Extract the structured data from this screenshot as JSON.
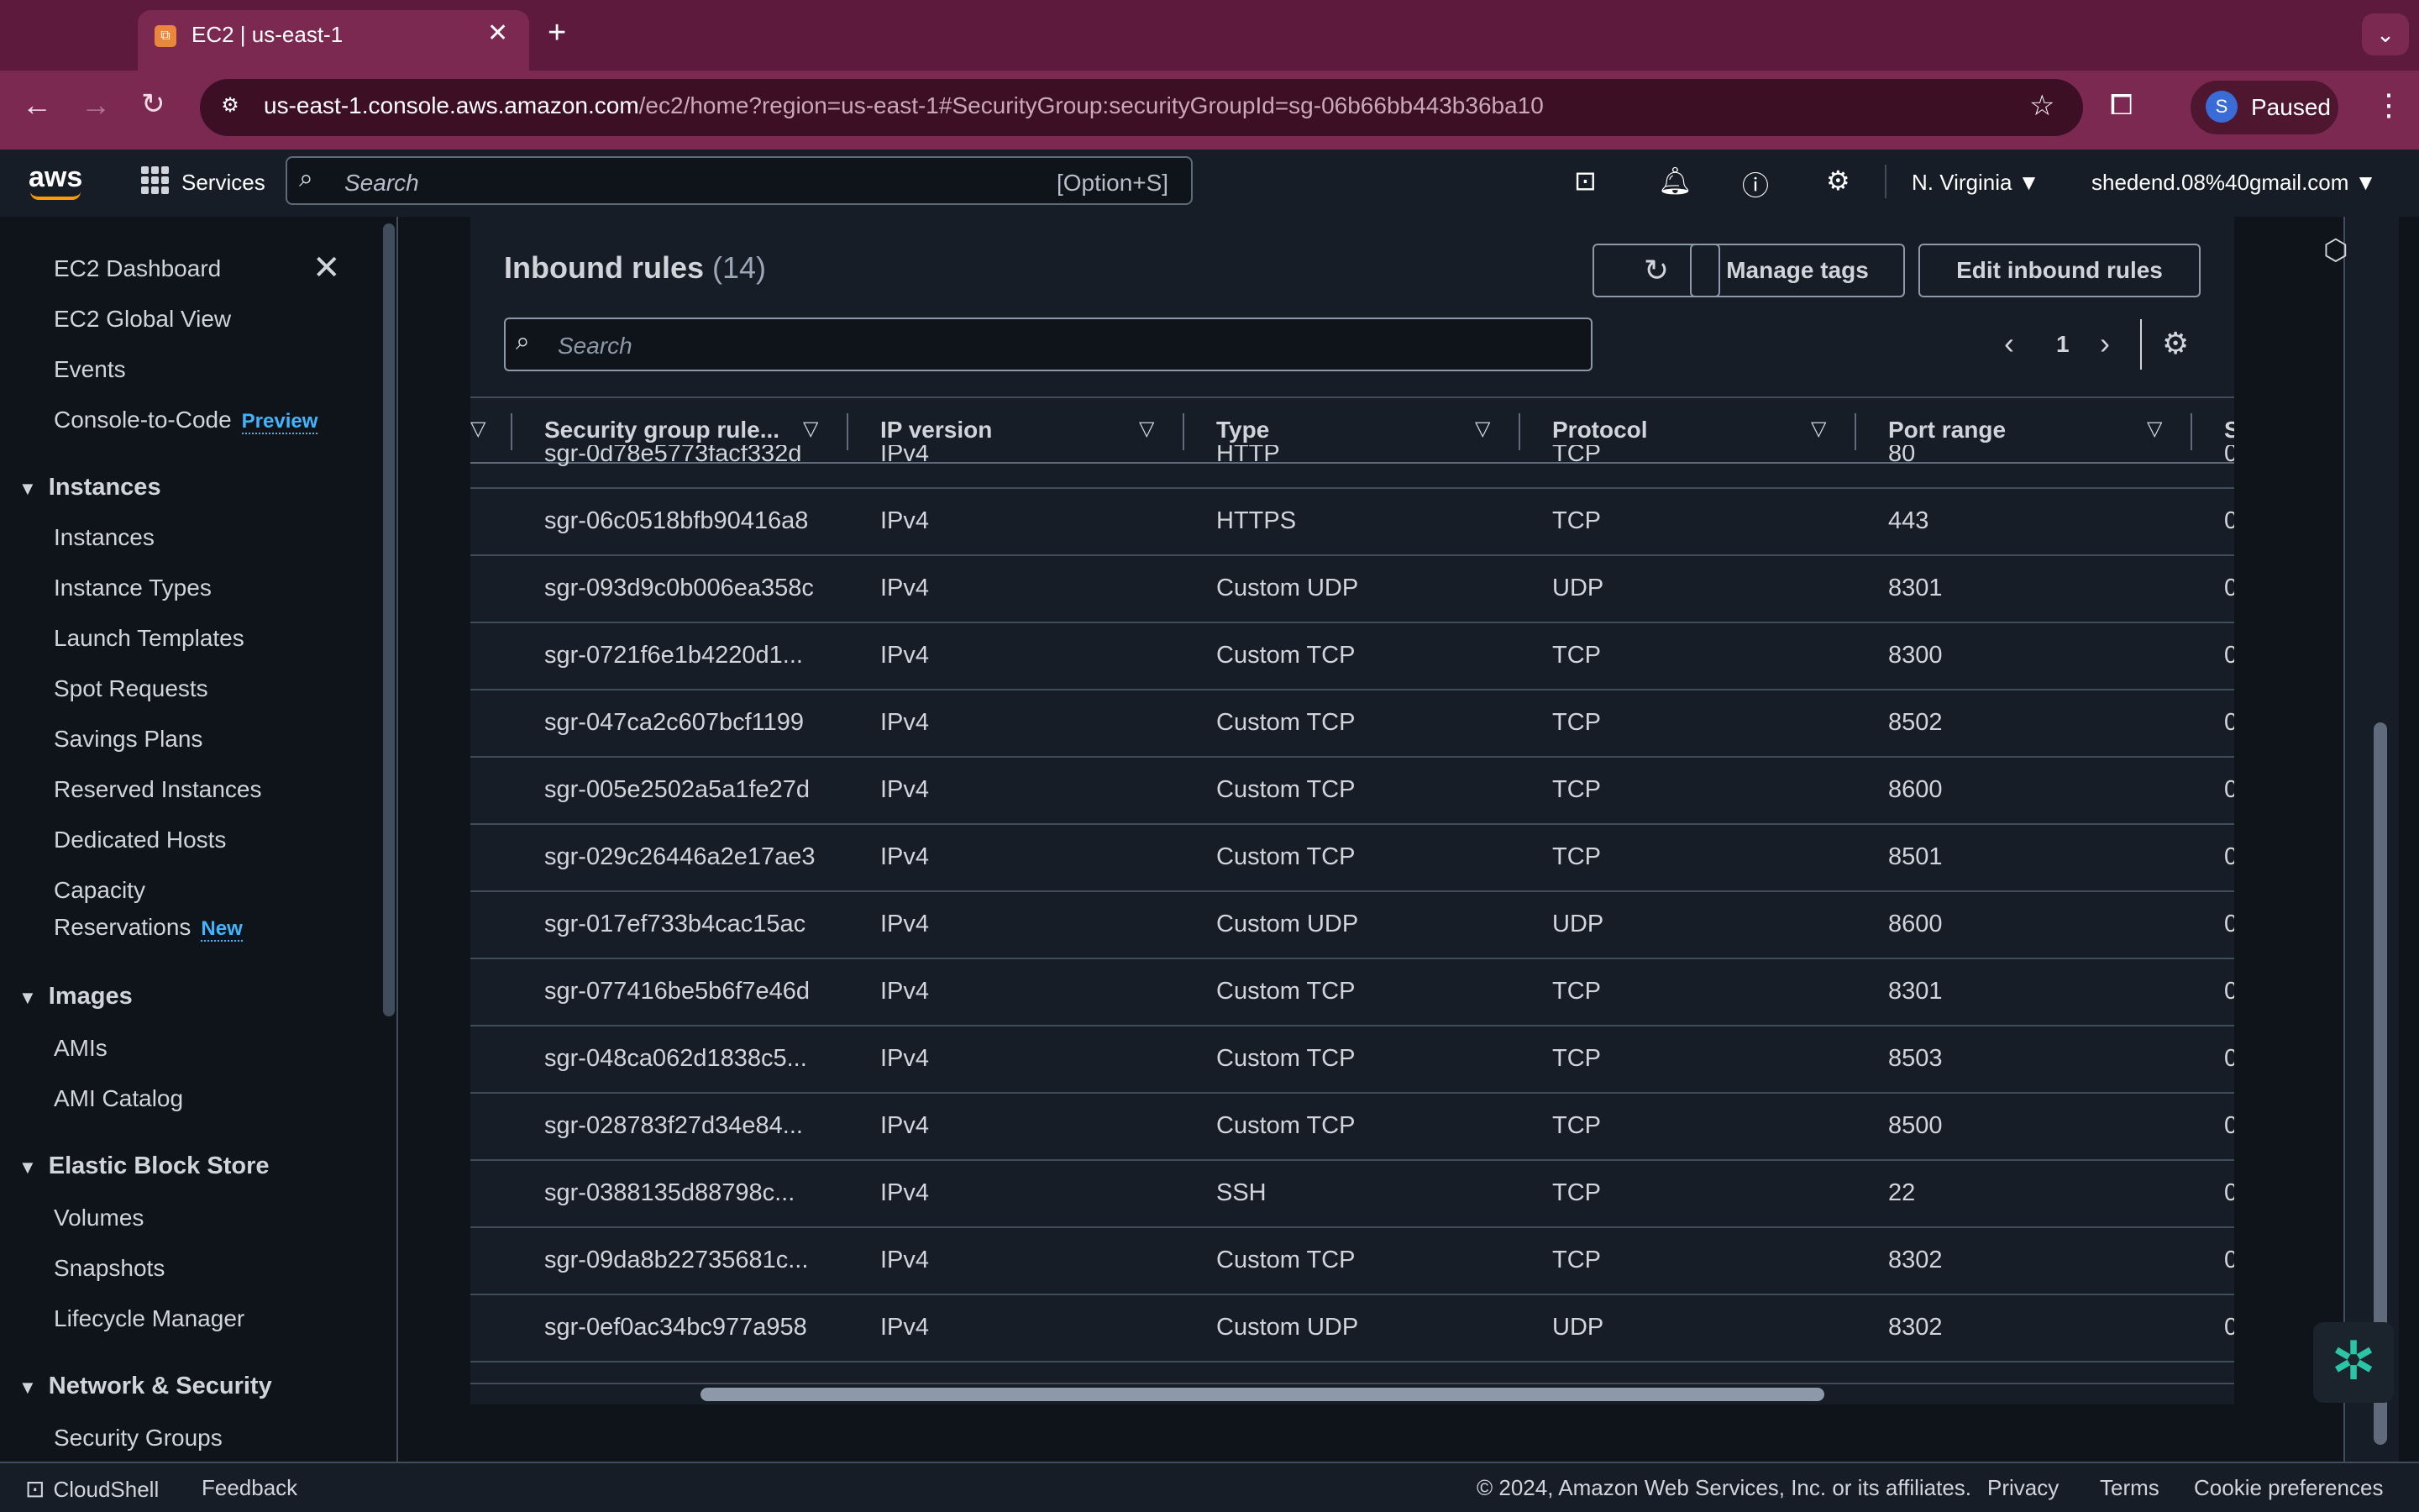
{
  "browser": {
    "tab_title": "EC2 | us-east-1",
    "url_host": "us-east-1.console.aws.amazon.com",
    "url_path": "/ec2/home?region=us-east-1#SecurityGroup:securityGroupId=sg-06b66bb443b36ba10",
    "profile_initial": "S",
    "profile_label": "Paused"
  },
  "awsnav": {
    "logo": "aws",
    "services_label": "Services",
    "search_placeholder": "Search",
    "search_shortcut": "[Option+S]",
    "region": "N. Virginia ▼",
    "account": "shedend.08%40gmail.com ▼"
  },
  "sidebar": {
    "top_items": [
      "EC2 Dashboard",
      "EC2 Global View",
      "Events",
      "Console-to-Code"
    ],
    "preview_tag": "Preview",
    "sections": [
      {
        "heading": "Instances",
        "items": [
          "Instances",
          "Instance Types",
          "Launch Templates",
          "Spot Requests",
          "Savings Plans",
          "Reserved Instances",
          "Dedicated Hosts",
          "Capacity",
          "Reservations"
        ]
      },
      {
        "heading": "Images",
        "items": [
          "AMIs",
          "AMI Catalog"
        ]
      },
      {
        "heading": "Elastic Block Store",
        "items": [
          "Volumes",
          "Snapshots",
          "Lifecycle Manager"
        ]
      },
      {
        "heading": "Network & Security",
        "items": [
          "Security Groups"
        ]
      }
    ],
    "new_tag": "New"
  },
  "inbound": {
    "title": "Inbound rules",
    "count": "(14)",
    "btn_manage_tags": "Manage tags",
    "btn_edit": "Edit inbound rules",
    "search_placeholder": "Search",
    "page": "1",
    "columns": [
      "Security group rule...",
      "IP version",
      "Type",
      "Protocol",
      "Port range",
      "S"
    ],
    "rows": [
      [
        "sgr-0d78e5773facf332d",
        "IPv4",
        "HTTP",
        "TCP",
        "80",
        "0"
      ],
      [
        "sgr-06c0518bfb90416a8",
        "IPv4",
        "HTTPS",
        "TCP",
        "443",
        "0"
      ],
      [
        "sgr-093d9c0b006ea358c",
        "IPv4",
        "Custom UDP",
        "UDP",
        "8301",
        "0"
      ],
      [
        "sgr-0721f6e1b4220d1...",
        "IPv4",
        "Custom TCP",
        "TCP",
        "8300",
        "0"
      ],
      [
        "sgr-047ca2c607bcf1199",
        "IPv4",
        "Custom TCP",
        "TCP",
        "8502",
        "0"
      ],
      [
        "sgr-005e2502a5a1fe27d",
        "IPv4",
        "Custom TCP",
        "TCP",
        "8600",
        "0"
      ],
      [
        "sgr-029c26446a2e17ae3",
        "IPv4",
        "Custom TCP",
        "TCP",
        "8501",
        "0"
      ],
      [
        "sgr-017ef733b4cac15ac",
        "IPv4",
        "Custom UDP",
        "UDP",
        "8600",
        "0"
      ],
      [
        "sgr-077416be5b6f7e46d",
        "IPv4",
        "Custom TCP",
        "TCP",
        "8301",
        "0"
      ],
      [
        "sgr-048ca062d1838c5...",
        "IPv4",
        "Custom TCP",
        "TCP",
        "8503",
        "0"
      ],
      [
        "sgr-028783f27d34e84...",
        "IPv4",
        "Custom TCP",
        "TCP",
        "8500",
        "0"
      ],
      [
        "sgr-0388135d88798c...",
        "IPv4",
        "SSH",
        "TCP",
        "22",
        "0"
      ],
      [
        "sgr-09da8b22735681c...",
        "IPv4",
        "Custom TCP",
        "TCP",
        "8302",
        "0"
      ],
      [
        "sgr-0ef0ac34bc977a958",
        "IPv4",
        "Custom UDP",
        "UDP",
        "8302",
        "0"
      ]
    ]
  },
  "footer": {
    "cloudshell": "CloudShell",
    "feedback": "Feedback",
    "copyright": "© 2024, Amazon Web Services, Inc. or its affiliates.",
    "privacy": "Privacy",
    "terms": "Terms",
    "cookies": "Cookie preferences"
  }
}
